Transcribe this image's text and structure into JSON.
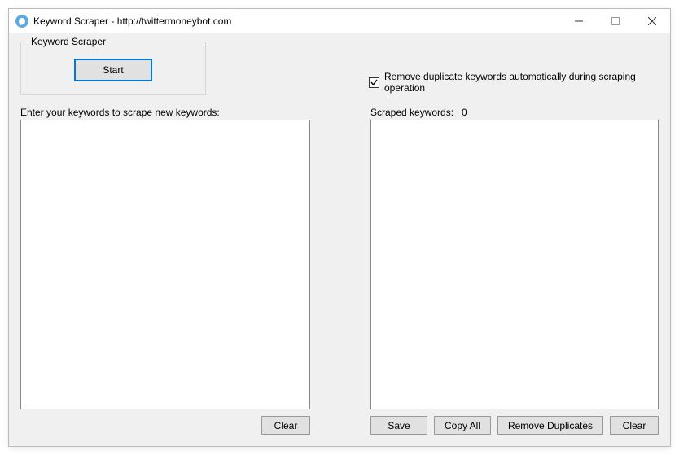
{
  "title": "Keyword Scraper - http://twittermoneybot.com",
  "group": {
    "legend": "Keyword Scraper",
    "start": "Start"
  },
  "remove_dup_checkbox": {
    "label": "Remove duplicate keywords automatically during scraping operation",
    "checked": true
  },
  "left": {
    "label": "Enter your keywords to scrape new keywords:",
    "value": "",
    "clear": "Clear"
  },
  "right": {
    "label": "Scraped keywords:",
    "count": "0",
    "value": "",
    "save": "Save",
    "copy": "Copy All",
    "remdup": "Remove Duplicates",
    "clear": "Clear"
  }
}
